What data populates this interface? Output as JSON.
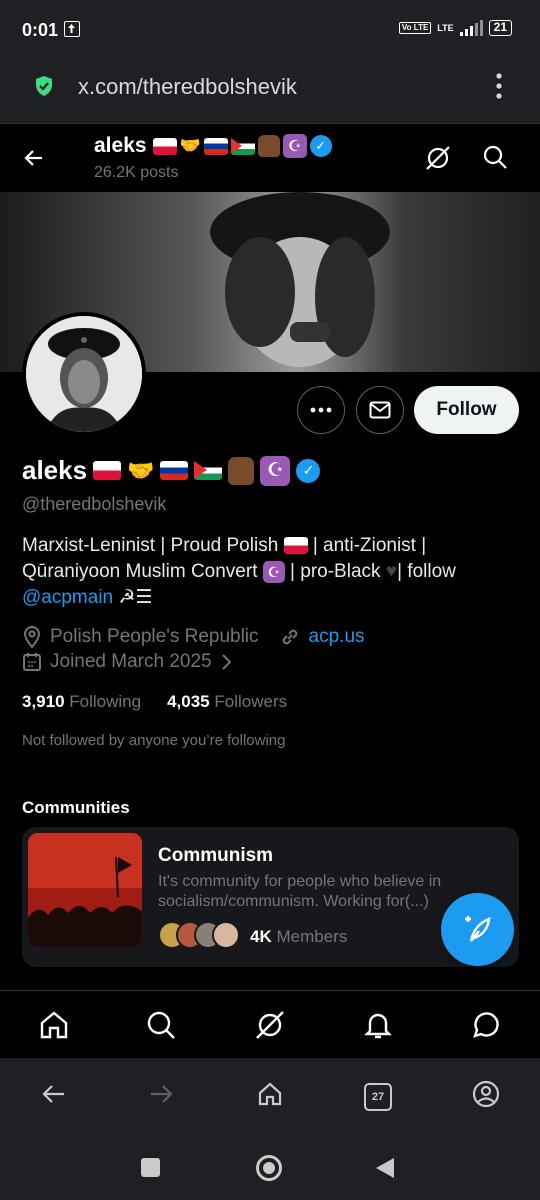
{
  "status_bar": {
    "time": "0:01",
    "volte": "Vo LTE",
    "network": "LTE",
    "battery": "21"
  },
  "browser": {
    "url": "x.com/theredbolshevik",
    "tab_count": "27"
  },
  "header": {
    "name": "aleks",
    "posts": "26.2K posts"
  },
  "profile": {
    "name": "aleks",
    "handle": "@theredbolshevik",
    "follow_label": "Follow",
    "bio_line1": "Marxist-Leninist | Proud Polish",
    "bio_line1b": "| anti-Zionist |",
    "bio_line2": "Qūraniyoon Muslim Convert",
    "bio_line2b": "| pro-Black",
    "bio_line2c": "| follow",
    "bio_mention": "@acpmain",
    "bio_tail": "☭☰",
    "location": "Polish People's Republic",
    "website": "acp.us",
    "joined": "Joined March 2025",
    "following_count": "3,910",
    "following_label": "Following",
    "followers_count": "4,035",
    "followers_label": "Followers",
    "not_followed": "Not followed by anyone you’re following"
  },
  "communities": {
    "title": "Communities",
    "items": [
      {
        "name": "Communism",
        "description": "It's community for people who believe in socialism/communism. Working for(...)",
        "members_count": "4K",
        "members_label": "Members"
      }
    ]
  },
  "icons": {
    "back": "arrow-left-icon",
    "grok": "grok-icon",
    "search": "search-icon",
    "more": "more-horizontal-icon",
    "message": "envelope-icon",
    "location": "location-pin-icon",
    "link": "link-icon",
    "calendar": "calendar-icon",
    "compose": "compose-post-icon"
  },
  "colors": {
    "accent": "#1d9bf0",
    "background": "#000000",
    "muted": "#71767b"
  }
}
